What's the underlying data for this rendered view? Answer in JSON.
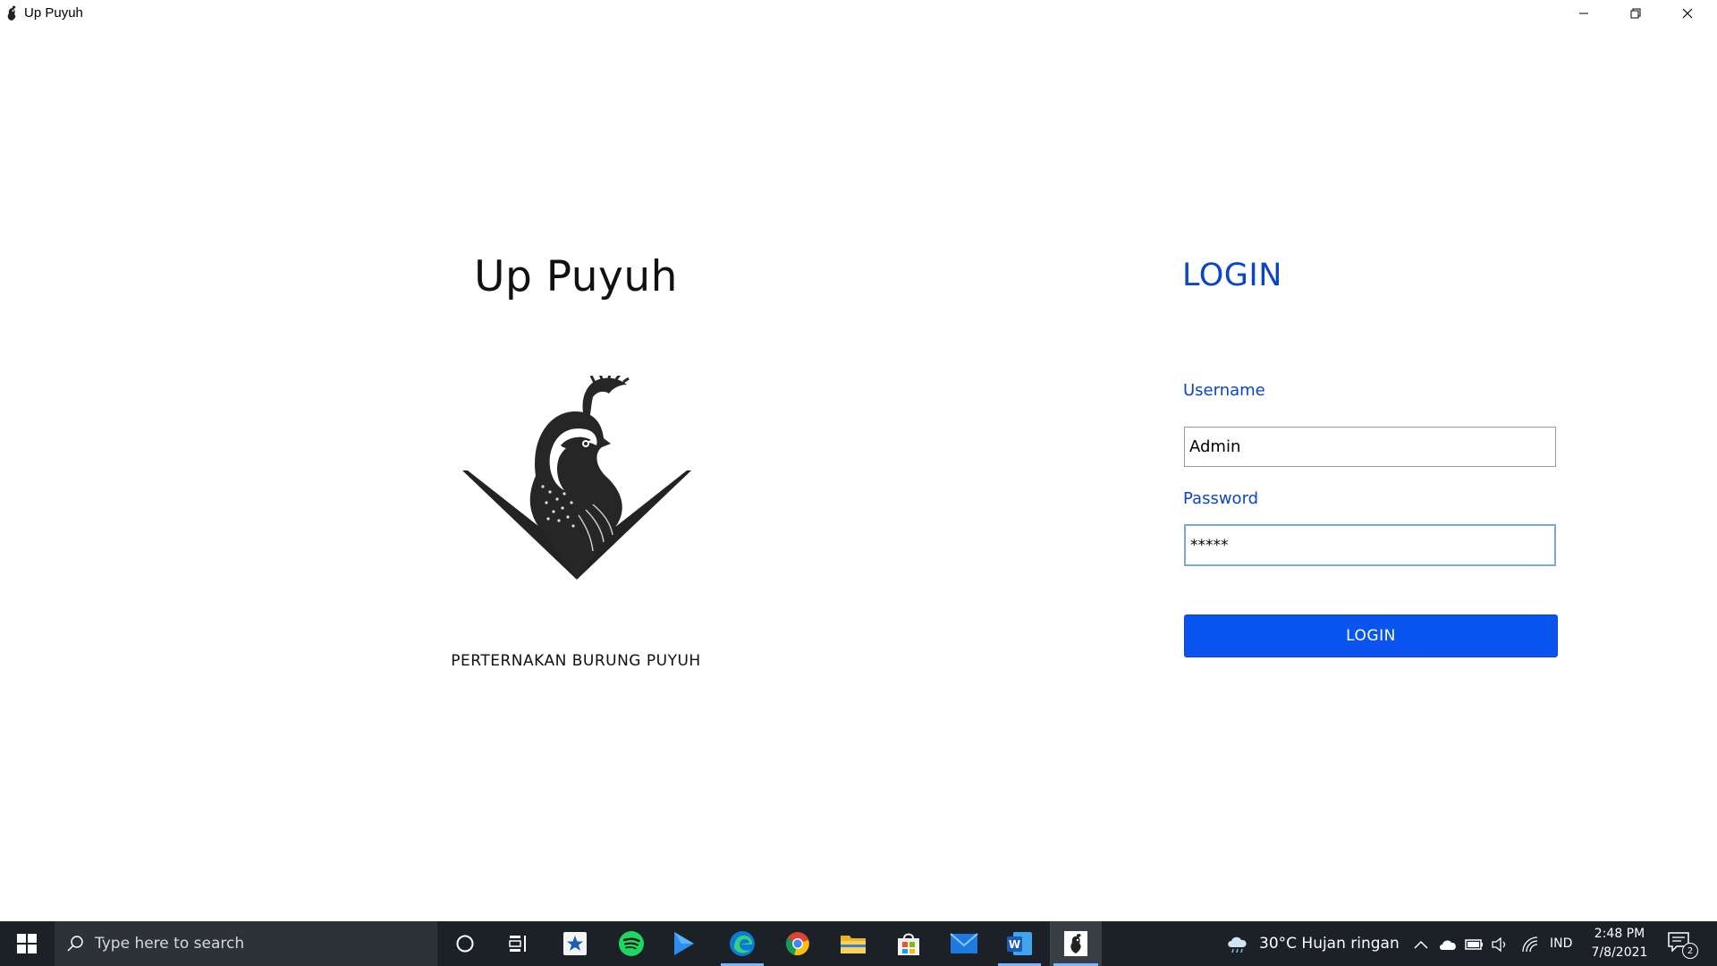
{
  "window": {
    "title": "Up Puyuh",
    "controls": [
      "minimize-icon",
      "maximize-icon",
      "close-icon"
    ]
  },
  "brand": {
    "title": "Up Puyuh",
    "subtitle": "PERTERNAKAN BURUNG PUYUH",
    "logo": "quail-logo"
  },
  "login": {
    "heading": "LOGIN",
    "username_label": "Username",
    "username_value": "Admin",
    "password_label": "Password",
    "password_value": "*****",
    "button_label": "LOGIN",
    "accent_color": "#0a45c8",
    "button_color": "#0a55f0"
  },
  "taskbar": {
    "search_placeholder": "Type here to search",
    "apps": [
      "cortana-icon",
      "task-view-icon",
      "app-star-icon",
      "spotify-icon",
      "media-player-icon",
      "edge-icon",
      "chrome-icon",
      "file-explorer-icon",
      "store-icon",
      "mail-icon",
      "word-icon",
      "up-puyuh-icon"
    ],
    "weather": "30°C  Hujan ringan",
    "language": "IND",
    "time": "2:48 PM",
    "date": "7/8/2021",
    "notification_count": "2"
  }
}
